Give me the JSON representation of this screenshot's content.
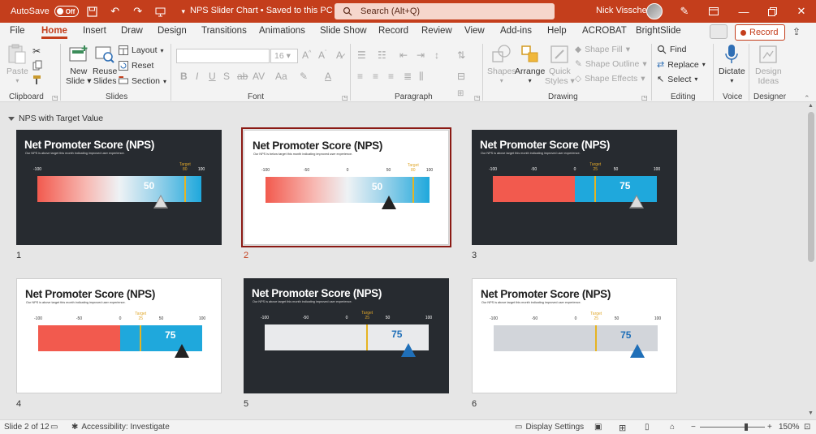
{
  "titlebar": {
    "autosave_label": "AutoSave",
    "autosave_state": "Off",
    "doc_title": "NPS Slider Chart • Saved to this PC",
    "search_placeholder": "Search (Alt+Q)",
    "user_name": "Nick Visscher"
  },
  "tabs": [
    "File",
    "Home",
    "Insert",
    "Draw",
    "Design",
    "Transitions",
    "Animations",
    "Slide Show",
    "Record",
    "Review",
    "View",
    "Add-ins",
    "Help",
    "ACROBAT",
    "BrightSlide"
  ],
  "active_tab": "Home",
  "record_label": "Record",
  "ribbon": {
    "clipboard": {
      "label": "Clipboard",
      "paste": "Paste"
    },
    "slides": {
      "label": "Slides",
      "new_slide_1": "New",
      "new_slide_2": "Slide",
      "reuse_1": "Reuse",
      "reuse_2": "Slides",
      "layout": "Layout",
      "reset": "Reset",
      "section": "Section"
    },
    "font": {
      "label": "Font",
      "size": "16"
    },
    "paragraph": {
      "label": "Paragraph"
    },
    "drawing": {
      "label": "Drawing",
      "shapes": "Shapes",
      "arrange": "Arrange",
      "quick_styles_1": "Quick",
      "quick_styles_2": "Styles",
      "shape_fill": "Shape Fill",
      "shape_outline": "Shape Outline",
      "shape_effects": "Shape Effects"
    },
    "editing": {
      "label": "Editing",
      "find": "Find",
      "replace": "Replace",
      "select": "Select"
    },
    "voice": {
      "label": "Voice",
      "dictate": "Dictate"
    },
    "designer": {
      "label": "Designer",
      "design_ideas_1": "Design",
      "design_ideas_2": "Ideas"
    }
  },
  "section_name": "NPS with Target Value",
  "slide_common": {
    "title": "Net Promoter Score (NPS)",
    "subtitle_above": "Our NPS is above target this month indicating improved user experience.",
    "subtitle_below": "Our NPS is below target this month indicating improved user experience.",
    "target_label": "Target"
  },
  "slides": [
    {
      "num": "1",
      "theme": "dark",
      "ticks": [
        "-100",
        "100"
      ],
      "value": "50",
      "target": "80",
      "subtitle": "above",
      "bar": "gradient"
    },
    {
      "num": "2",
      "theme": "light",
      "ticks": [
        "-100",
        "-50",
        "0",
        "50",
        "100"
      ],
      "value": "50",
      "target": "80",
      "subtitle": "below",
      "bar": "gradient",
      "selected": true
    },
    {
      "num": "3",
      "theme": "dark",
      "ticks": [
        "-100",
        "-50",
        "0",
        "50",
        "100"
      ],
      "value": "75",
      "target": "25",
      "subtitle": "above",
      "bar": "split"
    },
    {
      "num": "4",
      "theme": "light",
      "ticks": [
        "-100",
        "-50",
        "0",
        "50",
        "100"
      ],
      "value": "75",
      "target": "25",
      "subtitle": "above",
      "bar": "split"
    },
    {
      "num": "5",
      "theme": "dark",
      "ticks": [
        "-100",
        "-50",
        "0",
        "50",
        "100"
      ],
      "value": "75",
      "target": "25",
      "subtitle": "above",
      "bar": "flat-light"
    },
    {
      "num": "6",
      "theme": "light",
      "ticks": [
        "-100",
        "-50",
        "0",
        "50",
        "100"
      ],
      "value": "75",
      "target": "25",
      "subtitle": "above",
      "bar": "flat-grey"
    }
  ],
  "statusbar": {
    "slide_info": "Slide 2 of 12",
    "accessibility": "Accessibility: Investigate",
    "display_settings": "Display Settings",
    "zoom": "150%"
  },
  "colors": {
    "accent": "#c43e1c",
    "dark_slide": "#272b30",
    "red": "#f25a4e",
    "blue": "#1fa8dc",
    "target": "#e6b422",
    "pointer_blue": "#1f6fb8"
  }
}
